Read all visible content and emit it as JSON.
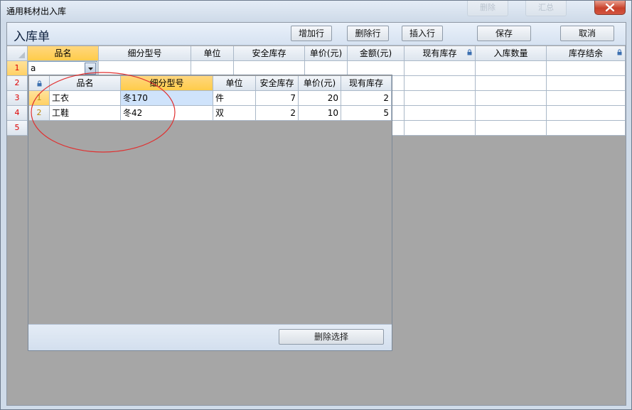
{
  "window": {
    "title": "通用耗材出入库",
    "ghost_buttons": [
      "删除",
      "汇总"
    ]
  },
  "toolbar": {
    "form_title": "入库单",
    "add_row": "增加行",
    "delete_row": "删除行",
    "insert_row": "插入行",
    "save": "保存",
    "cancel": "取消"
  },
  "grid": {
    "columns": [
      "品名",
      "细分型号",
      "单位",
      "安全库存",
      "单价(元)",
      "金额(元)",
      "现有库存",
      "入库数量",
      "库存结余"
    ],
    "row_numbers": [
      "1",
      "2",
      "3",
      "4",
      "5"
    ],
    "editor_value": "a"
  },
  "popup": {
    "columns": [
      "品名",
      "细分型号",
      "单位",
      "安全库存",
      "单价(元)",
      "现有库存"
    ],
    "rows": [
      {
        "num": "1",
        "name": "工衣",
        "model": "冬170",
        "unit": "件",
        "safety": "7",
        "price": "20",
        "stock": "2"
      },
      {
        "num": "2",
        "name": "工鞋",
        "model": "冬42",
        "unit": "双",
        "safety": "2",
        "price": "10",
        "stock": "5"
      }
    ],
    "delete_selected": "删除选择"
  },
  "colors": {
    "header_active": "#ffcc4a",
    "row_number": "#dd0000",
    "annotation_circle": "#e03030"
  }
}
